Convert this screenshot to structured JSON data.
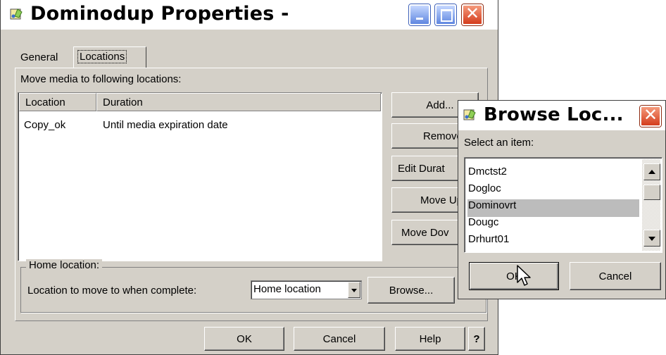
{
  "main_window": {
    "title": "Dominodup Properties -",
    "tabs": [
      {
        "label": "General",
        "active": false
      },
      {
        "label": "Locations",
        "active": true
      }
    ],
    "instruction": "Move media to following locations:",
    "table": {
      "columns": [
        "Location",
        "Duration"
      ],
      "rows": [
        {
          "location": "Copy_ok",
          "duration": "Until media expiration date"
        }
      ]
    },
    "side_buttons": [
      "Add...",
      "Remove",
      "Edit Durat",
      "Move Up",
      "Move Dov"
    ],
    "home_group": {
      "legend": "Home location:",
      "label": "Location to move to when complete:",
      "combo_value": "Home location",
      "browse_label": "Browse..."
    },
    "footer_buttons": {
      "ok": "OK",
      "cancel": "Cancel",
      "help": "Help",
      "question": "?"
    }
  },
  "browse_window": {
    "title": "Browse Loc...",
    "prompt": "Select an item:",
    "items": [
      "Dmctst2",
      "Dogloc",
      "Dominovrt",
      "Dougc",
      "Drhurt01"
    ],
    "selected": "Dominovrt",
    "ok_label": "OK",
    "cancel_label": "Cancel"
  },
  "colors": {
    "face": "#d4d0c8",
    "selection": "#bcbcbc",
    "close_red": "#d43c1c",
    "title_blue": "#5f86e0"
  },
  "icons": [
    "app-icon",
    "minimize-icon",
    "maximize-icon",
    "close-icon",
    "mouse-cursor-icon"
  ]
}
